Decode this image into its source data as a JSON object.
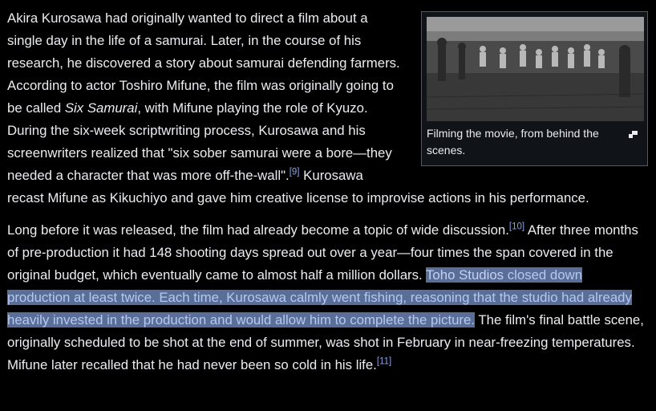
{
  "figure": {
    "caption": "Filming the movie, from behind the scenes.",
    "image_alt": "Black and white still of a film crew and onlookers in a field",
    "enlarge_icon": "magnify-clip-icon"
  },
  "paragraph1": {
    "t1": "Akira Kurosawa had originally wanted to direct a film about a single day in the life of a samurai. Later, in the course of his research, he discovered a story about samurai defending farmers. According to actor Toshiro Mifune, the film was originally going to be called ",
    "italic_title": "Six Samurai",
    "t2": ", with Mifune playing the role of Kyuzo. During the six-week scriptwriting process, Kurosawa and his screenwriters realized that \"six sober samurai were a bore—they needed a character that was more off-the-wall\".",
    "ref1": "[9]",
    "t3": " Kurosawa recast Mifune as Kikuchiyo and gave him creative license to improvise actions in his performance."
  },
  "paragraph2": {
    "t1": "Long before it was released, the film had already become a topic of wide discussion.",
    "ref1": "[10]",
    "t2": " After three months of pre-production it had 148 shooting days spread out over a year—four times the span covered in the original budget, which eventually came to almost half a million dollars. ",
    "selected_start": "Toho Studios",
    "selected_rest": " closed down production at least twice. Each time, Kurosawa calmly went fishing, reasoning that the studio had already heavily invested in the production and would allow him to complete the picture.",
    "t3": " The film's final battle scene, originally scheduled to be shot at the end of summer, was shot in February in near-freezing temperatures. Mifune later recalled that he had never been so cold in his life.",
    "ref2": "[11]"
  },
  "colors": {
    "background": "#000000",
    "text": "#eaecf0",
    "link": "#88a3e8",
    "selection": "#5a6f97"
  }
}
